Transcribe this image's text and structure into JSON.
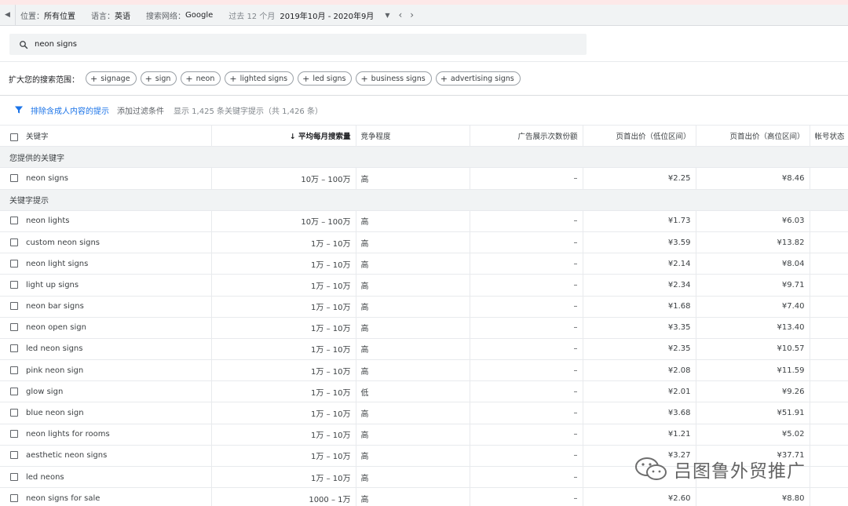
{
  "topbar": {
    "location_label": "位置：",
    "location_value": "所有位置",
    "language_label": "语言：",
    "language_value": "英语",
    "network_label": "搜索网络：",
    "network_value": "Google",
    "period_label": "过去 12 个月",
    "period_value": "2019年10月 - 2020年9月"
  },
  "search": {
    "value": "neon signs"
  },
  "broaden": {
    "label": "扩大您的搜索范围：",
    "chips": [
      "signage",
      "sign",
      "neon",
      "lighted signs",
      "led signs",
      "business signs",
      "advertising signs"
    ]
  },
  "filters": {
    "exclude_adult": "排除含成人内容的提示",
    "add_filter": "添加过滤条件",
    "count_text": "显示 1,425 条关键字提示（共 1,426 条）"
  },
  "table": {
    "headers": {
      "keyword": "关键字",
      "avg_searches": "平均每月搜索量",
      "competition": "竞争程度",
      "impression_share": "广告展示次数份额",
      "bid_low": "页首出价（低位区间）",
      "bid_high": "页首出价（高位区间）",
      "account_status": "帐号状态"
    },
    "provided_group": "您提供的关键字",
    "provided": [
      {
        "keyword": "neon signs",
        "searches": "10万 – 100万",
        "competition": "高",
        "share": "–",
        "low": "¥2.25",
        "high": "¥8.46"
      }
    ],
    "ideas_group": "关键字提示",
    "ideas": [
      {
        "keyword": "neon lights",
        "searches": "10万 – 100万",
        "competition": "高",
        "share": "–",
        "low": "¥1.73",
        "high": "¥6.03"
      },
      {
        "keyword": "custom neon signs",
        "searches": "1万 – 10万",
        "competition": "高",
        "share": "–",
        "low": "¥3.59",
        "high": "¥13.82"
      },
      {
        "keyword": "neon light signs",
        "searches": "1万 – 10万",
        "competition": "高",
        "share": "–",
        "low": "¥2.14",
        "high": "¥8.04"
      },
      {
        "keyword": "light up signs",
        "searches": "1万 – 10万",
        "competition": "高",
        "share": "–",
        "low": "¥2.34",
        "high": "¥9.71"
      },
      {
        "keyword": "neon bar signs",
        "searches": "1万 – 10万",
        "competition": "高",
        "share": "–",
        "low": "¥1.68",
        "high": "¥7.40"
      },
      {
        "keyword": "neon open sign",
        "searches": "1万 – 10万",
        "competition": "高",
        "share": "–",
        "low": "¥3.35",
        "high": "¥13.40"
      },
      {
        "keyword": "led neon signs",
        "searches": "1万 – 10万",
        "competition": "高",
        "share": "–",
        "low": "¥2.35",
        "high": "¥10.57"
      },
      {
        "keyword": "pink neon sign",
        "searches": "1万 – 10万",
        "competition": "高",
        "share": "–",
        "low": "¥2.08",
        "high": "¥11.59"
      },
      {
        "keyword": "glow sign",
        "searches": "1万 – 10万",
        "competition": "低",
        "share": "–",
        "low": "¥2.01",
        "high": "¥9.26"
      },
      {
        "keyword": "blue neon sign",
        "searches": "1万 – 10万",
        "competition": "高",
        "share": "–",
        "low": "¥3.68",
        "high": "¥51.91"
      },
      {
        "keyword": "neon lights for rooms",
        "searches": "1万 – 10万",
        "competition": "高",
        "share": "–",
        "low": "¥1.21",
        "high": "¥5.02"
      },
      {
        "keyword": "aesthetic neon signs",
        "searches": "1万 – 10万",
        "competition": "高",
        "share": "–",
        "low": "¥3.27",
        "high": "¥37.71"
      },
      {
        "keyword": "led neons",
        "searches": "1万 – 10万",
        "competition": "高",
        "share": "–",
        "low": "",
        "high": ""
      },
      {
        "keyword": "neon signs for sale",
        "searches": "1000 – 1万",
        "competition": "高",
        "share": "–",
        "low": "¥2.60",
        "high": "¥8.80"
      }
    ]
  },
  "watermark": {
    "text": "吕图鲁外贸推广"
  },
  "colors": {
    "accent": "#1a73e8",
    "topbar_bg": "#f1f3f4",
    "group_bg": "#f1f3f4"
  }
}
